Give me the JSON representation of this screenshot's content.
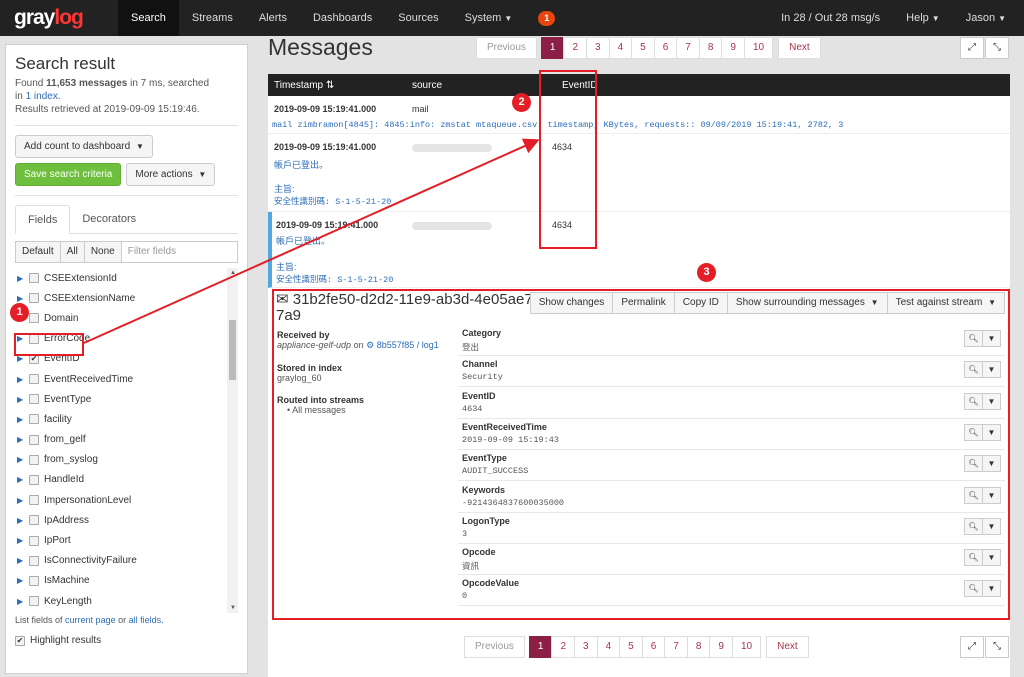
{
  "nav": {
    "logo_main": "gray",
    "logo_accent": "log",
    "items": [
      "Search",
      "Streams",
      "Alerts",
      "Dashboards",
      "Sources",
      "System"
    ],
    "badge": "1",
    "throughput": "In 28 / Out 28 msg/s",
    "help": "Help",
    "user": "Jason"
  },
  "sidebar": {
    "title": "Search result",
    "found_prefix": "Found",
    "found_count": "11,653 messages",
    "found_suffix": "in 7 ms, searched",
    "in_prefix": "in",
    "index_link": "1 index.",
    "retrieved": "Results retrieved at 2019-09-09 15:19:46.",
    "add_count": "Add count to dashboard",
    "save_search": "Save search criteria",
    "more_actions": "More actions",
    "tab_fields": "Fields",
    "tab_decorators": "Decorators",
    "filter_default": "Default",
    "filter_all": "All",
    "filter_none": "None",
    "filter_placeholder": "Filter fields",
    "fields": [
      "CSEExtensionId",
      "CSEExtensionName",
      "Domain",
      "ErrorCode",
      "EventID",
      "EventReceivedTime",
      "EventType",
      "facility",
      "from_gelf",
      "from_syslog",
      "HandleId",
      "ImpersonationLevel",
      "IpAddress",
      "IpPort",
      "IsConnectivityFailure",
      "IsMachine",
      "KeyLength"
    ],
    "list_prefix": "List fields of",
    "current_page": "current page",
    "or": "or",
    "all_fields": "all fields.",
    "highlight": "Highlight results"
  },
  "main": {
    "title": "Messages",
    "pager": [
      "Previous",
      "1",
      "2",
      "3",
      "4",
      "5",
      "6",
      "7",
      "8",
      "9",
      "10",
      "Next"
    ]
  },
  "table": {
    "col_timestamp": "Timestamp",
    "col_source": "source",
    "col_eventid": "EventID",
    "rows": [
      {
        "timestamp": "2019-09-09 15:19:41.000",
        "source": "mail",
        "eventid": "",
        "message": "mail zimbramon[4845]: 4845:info: zmstat mtaqueue.csv: timestamp, KBytes, requests:: 09/09/2019 15:19:41, 2782, 3",
        "line2": "",
        "line3": "",
        "line4": ""
      },
      {
        "timestamp": "2019-09-09 15:19:41.000",
        "source": "",
        "eventid": "4634",
        "message": "",
        "line2": "帳戶已登出。",
        "line3": "主旨:",
        "line4": "安全性識別碼:  S-1-5-21-20"
      },
      {
        "timestamp": "2019-09-09 15:19:41.000",
        "source": "",
        "eventid": "4634",
        "message": "",
        "line2": "帳戶已登出。",
        "line3": "主旨:",
        "line4": "安全性識別碼:  S-1-5-21-20"
      }
    ]
  },
  "detail": {
    "id": "31b2fe50-d2d2-11e9-ab3d-4e05ae76d7a9",
    "buttons": [
      "Show changes",
      "Permalink",
      "Copy ID",
      "Show surrounding messages",
      "Test against stream"
    ],
    "received_by_label": "Received by",
    "received_by": "appliance-gelf-udp",
    "received_on": "on",
    "received_node": "8b557f85 / log1",
    "stored_label": "Stored in index",
    "stored": "graylog_60",
    "routed_label": "Routed into streams",
    "routed": "All messages",
    "fields": [
      {
        "name": "Category",
        "value": "登出"
      },
      {
        "name": "Channel",
        "value": "Security"
      },
      {
        "name": "EventID",
        "value": "4634"
      },
      {
        "name": "EventReceivedTime",
        "value": "2019-09-09 15:19:43"
      },
      {
        "name": "EventType",
        "value": "AUDIT_SUCCESS"
      },
      {
        "name": "Keywords",
        "value": "-9214364837600035000"
      },
      {
        "name": "LogonType",
        "value": "3"
      },
      {
        "name": "Opcode",
        "value": "資訊"
      },
      {
        "name": "OpcodeValue",
        "value": "0"
      }
    ]
  },
  "markers": [
    "1",
    "2",
    "3"
  ],
  "colors": {
    "accent": "#8c1f45",
    "annotation": "#e41e26",
    "brand": "#ff3633"
  }
}
